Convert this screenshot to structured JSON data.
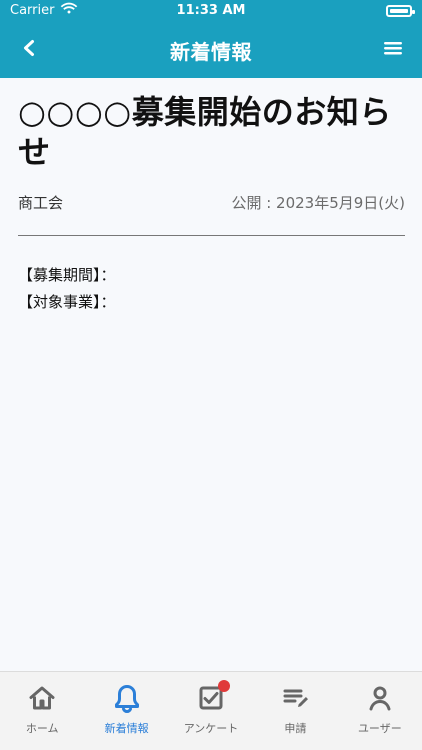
{
  "colors": {
    "primary": "#1aa0bf",
    "tab_active": "#2c7fd8",
    "tab_inactive": "#666666",
    "badge": "#e03a3a"
  },
  "status_bar": {
    "carrier": "Carrier",
    "time": "11:33 AM"
  },
  "header": {
    "title": "新着情報",
    "back_icon": "chevron-left-icon",
    "menu_icon": "hamburger-menu-icon"
  },
  "article": {
    "title": "○○○○募集開始のお知らせ",
    "author": "商工会",
    "published": "公開 : 2023年5月9日(火)",
    "details": [
      "【募集期間】：",
      "【対象事業】："
    ]
  },
  "tabbar": {
    "items": [
      {
        "label": "ホーム",
        "icon": "home-icon",
        "active": false,
        "badge": false
      },
      {
        "label": "新着情報",
        "icon": "bell-icon",
        "active": true,
        "badge": false
      },
      {
        "label": "アンケート",
        "icon": "checkbox-icon",
        "active": false,
        "badge": true
      },
      {
        "label": "申請",
        "icon": "edit-list-icon",
        "active": false,
        "badge": false
      },
      {
        "label": "ユーザー",
        "icon": "user-icon",
        "active": false,
        "badge": false
      }
    ]
  }
}
